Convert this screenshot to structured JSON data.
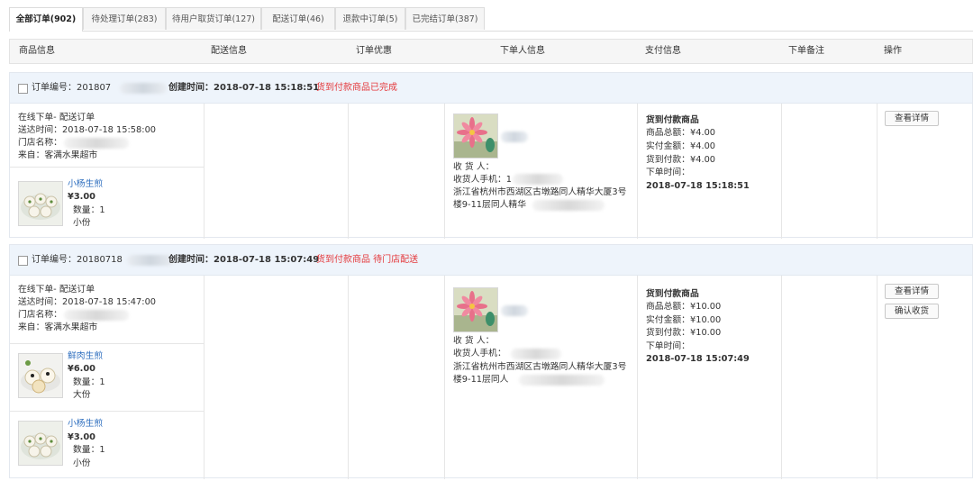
{
  "tabs": [
    {
      "label": "全部订单(902)"
    },
    {
      "label": "待处理订单(283)"
    },
    {
      "label": "待用户取货订单(127)"
    },
    {
      "label": "配送订单(46)"
    },
    {
      "label": "退款中订单(5)"
    },
    {
      "label": "已完结订单(387)"
    }
  ],
  "columns": {
    "product": "商品信息",
    "delivery": "配送信息",
    "discount": "订单优惠",
    "buyer": "下单人信息",
    "payment": "支付信息",
    "remark": "下单备注",
    "actions": "操作"
  },
  "orders": [
    {
      "order_no": "订单编号：201807",
      "created": "创建时间：2018-07-18 15:18:51",
      "status": "货到付款商品已完成",
      "info": {
        "line1": "在线下单- 配送订单",
        "line2": "送达时间：2018-07-18 15:58:00",
        "line3": "门店名称：",
        "line4": "来自：客满水果超市"
      },
      "items": [
        {
          "name": "小杨生煎",
          "price": "¥3.00",
          "qty": "数量：1",
          "spec": "小份"
        }
      ],
      "buyer": {
        "receiver": "收 货 人：",
        "phone": "收货人手机：1",
        "addr1": "浙江省杭州市西湖区古墩路同人精华大厦3号",
        "addr2": "楼9-11层同人精华"
      },
      "payment": {
        "type": "货到付款商品",
        "total": "商品总额：¥4.00",
        "actual": "实付金额：¥4.00",
        "cod": "货到付款：¥4.00",
        "time_label": "下单时间：",
        "time": "2018-07-18 15:18:51"
      },
      "actions": [
        "查看详情"
      ]
    },
    {
      "order_no": "订单编号：20180718",
      "created": "创建时间：2018-07-18 15:07:49",
      "status": "货到付款商品 待门店配送",
      "info": {
        "line1": "在线下单- 配送订单",
        "line2": "送达时间：2018-07-18 15:47:00",
        "line3": "门店名称：",
        "line4": "来自：客满水果超市"
      },
      "items": [
        {
          "name": "鲜肉生煎",
          "price": "¥6.00",
          "qty": "数量：1",
          "spec": "大份"
        },
        {
          "name": "小杨生煎",
          "price": "¥3.00",
          "qty": "数量：1",
          "spec": "小份"
        }
      ],
      "buyer": {
        "receiver": "收 货 人：",
        "phone": "收货人手机：",
        "addr1": "浙江省杭州市西湖区古墩路同人精华大厦3号",
        "addr2": "楼9-11层同人"
      },
      "payment": {
        "type": "货到付款商品",
        "total": "商品总额：¥10.00",
        "actual": "实付金额：¥10.00",
        "cod": "货到付款：¥10.00",
        "time_label": "下单时间：",
        "time": "2018-07-18 15:07:49"
      },
      "actions": [
        "查看详情",
        "确认收货"
      ]
    }
  ]
}
